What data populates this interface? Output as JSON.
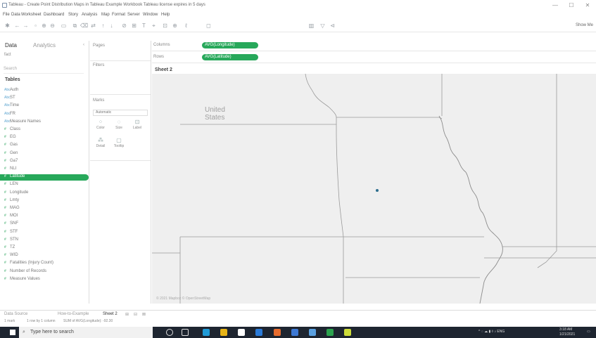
{
  "window": {
    "title": "Tableau - Create Point Distribution Maps in Tableau Example Workbook  Tableau license expires in 5 days",
    "controls": [
      "—",
      "☐",
      "✕"
    ]
  },
  "menu": [
    "File",
    "Data",
    "Worksheet",
    "Dashboard",
    "Story",
    "Analysis",
    "Map",
    "Format",
    "Server",
    "Window",
    "Help"
  ],
  "toolbar": {
    "show_me": "Show Me"
  },
  "data_pane": {
    "tab_data": "Data",
    "tab_analytics": "Analytics",
    "datasource": "fact",
    "search_placeholder": "Search",
    "tables_heading": "Tables",
    "fields": [
      {
        "label": "Auth",
        "kind": "dim"
      },
      {
        "label": "ST",
        "kind": "dim"
      },
      {
        "label": "Time",
        "kind": "dim"
      },
      {
        "label": "FR",
        "kind": "dim"
      },
      {
        "label": "Measure Names",
        "kind": "dim"
      },
      {
        "label": "Class",
        "kind": "measure"
      },
      {
        "label": "EG",
        "kind": "measure"
      },
      {
        "label": "Gas",
        "kind": "measure"
      },
      {
        "label": "Gen",
        "kind": "measure"
      },
      {
        "label": "Ga7",
        "kind": "measure"
      },
      {
        "label": "NLI",
        "kind": "measure"
      },
      {
        "label": "Latitude",
        "kind": "measure",
        "selected": true
      },
      {
        "label": "LEN",
        "kind": "measure"
      },
      {
        "label": "Longitude",
        "kind": "measure"
      },
      {
        "label": "Lmty",
        "kind": "measure"
      },
      {
        "label": "MAG",
        "kind": "measure"
      },
      {
        "label": "MOI",
        "kind": "measure"
      },
      {
        "label": "SNF",
        "kind": "measure"
      },
      {
        "label": "STF",
        "kind": "measure"
      },
      {
        "label": "STN",
        "kind": "measure"
      },
      {
        "label": "TZ",
        "kind": "measure"
      },
      {
        "label": "WID",
        "kind": "measure"
      },
      {
        "label": "Fatalities (Injury Count)",
        "kind": "measure"
      },
      {
        "label": "Number of Records",
        "kind": "measure"
      },
      {
        "label": "Measure Values",
        "kind": "measure"
      }
    ]
  },
  "cards": {
    "pages": "Pages",
    "filters": "Filters",
    "marks": "Marks",
    "mark_type": "Automatic",
    "mark_buttons": [
      {
        "label": "Color",
        "icon": "⁘"
      },
      {
        "label": "Size",
        "icon": "◌"
      },
      {
        "label": "Label",
        "icon": "⊡"
      },
      {
        "label": "Detail",
        "icon": "⁂"
      },
      {
        "label": "Tooltip",
        "icon": "▢"
      }
    ]
  },
  "shelves": {
    "columns_label": "Columns",
    "rows_label": "Rows",
    "columns_pill": "AVG(Longitude)",
    "rows_pill": "AVG(Latitude)"
  },
  "sheet": {
    "title": "Sheet 2",
    "map_label": "United\nStates",
    "attribution": "© 2021 Mapbox © OpenStreetMap",
    "point": {
      "longitude": -92.3,
      "latitude": 38.5
    },
    "colors": {
      "map_bg": "#efefef",
      "border": "#9a9a9a",
      "mark": "#2e6e8e",
      "accent": "#27a85a"
    }
  },
  "sheet_tabs": {
    "data_source": "Data Source",
    "sheet1": "How-to-Example",
    "active": "Sheet 2",
    "add_icons": [
      "⊞",
      "⊟",
      "⊠"
    ]
  },
  "status": {
    "marks": "1 mark",
    "rows_cols": "1 row by 1 column",
    "sum": "SUM of AVG(Longitude): -92.30"
  },
  "taskbar": {
    "search_placeholder": "Type here to search",
    "time": "3:18 AM",
    "date": "1/21/2021"
  }
}
